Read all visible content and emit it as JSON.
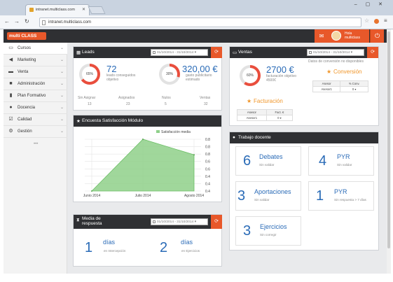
{
  "browser": {
    "tab_title": "intranet.multiclass.com",
    "url": "intranet.multiclass.com",
    "window_buttons": "– ▢ ✕"
  },
  "app": {
    "logo_prefix": "multi",
    "logo_main": "CLASS",
    "user_name": "Hola multiclass"
  },
  "sidebar": {
    "items": [
      {
        "label": "Cursos",
        "icon": "folder-icon"
      },
      {
        "label": "Marketing",
        "icon": "megaphone-icon"
      },
      {
        "label": "Venta",
        "icon": "card-icon"
      },
      {
        "label": "Administración",
        "icon": "briefcase-icon"
      },
      {
        "label": "Plan Formativo",
        "icon": "book-icon"
      },
      {
        "label": "Docencia",
        "icon": "users-icon"
      },
      {
        "label": "Calidad",
        "icon": "check-icon"
      },
      {
        "label": "Gestión",
        "icon": "gears-icon"
      }
    ]
  },
  "leads": {
    "title": "Leads",
    "date_range": "01/10/2014 - 31/10/2014",
    "ring_percent": "65%",
    "ring_value": 0.65,
    "count": "72",
    "count_caption": "leads conseguidos objetivo",
    "money": "320,00 €",
    "money_caption": "gasto publicitario estimado",
    "money_ring_percent": "30%",
    "money_ring_value": 0.3,
    "stats": [
      {
        "label": "Sin Asignar",
        "value": "13"
      },
      {
        "label": "Asignados",
        "value": "23"
      },
      {
        "label": "Nulos",
        "value": "5"
      },
      {
        "label": "Ventas",
        "value": "32"
      }
    ]
  },
  "ventas": {
    "title": "Ventas",
    "date_range": "01/10/2014 - 31/10/2014",
    "ring_percent": "60%",
    "ring_value": 0.6,
    "money": "2700 €",
    "money_caption": "facturación objetivo 4500€",
    "conv_note": "Datos de conversión no disponibles",
    "conversion_title": "Conversión",
    "conv_headers": [
      "Asesor",
      "% Conv."
    ],
    "conv_rows": [
      [
        "Asesor1",
        "0 ▾"
      ]
    ],
    "facturacion_title": "Facturación",
    "fact_headers": [
      "Asesor",
      "Fact. €"
    ],
    "fact_rows": [
      [
        "Asesor1",
        "0 ▾"
      ]
    ]
  },
  "encuesta": {
    "title": "Encuesta Satisfacción Módulo",
    "legend": "Satisfacción media",
    "chart_data": {
      "type": "area",
      "title": "Encuesta Satisfacción Módulo",
      "categories": [
        "Junio 2014",
        "Julio 2014",
        "Agosto 2014"
      ],
      "series": [
        {
          "name": "Satisfacción media",
          "values": [
            0.4,
            0.8,
            0.68
          ]
        }
      ],
      "ylim": [
        0.4,
        0.8
      ],
      "yticks": [
        "0.8",
        "0.8",
        "0.8",
        "0.6",
        "0.6",
        "0.4",
        "0.4",
        "0.4"
      ],
      "legend_position": "top-right",
      "grid": true,
      "color": "#8fd08a"
    }
  },
  "trabajo": {
    "title": "Trabajo docente",
    "cells": [
      {
        "n": "6",
        "title": "Debates",
        "sub": "Sin validar"
      },
      {
        "n": "4",
        "title": "PYR",
        "sub": "Sin validar"
      },
      {
        "n": "3",
        "title": "Aportaciones",
        "sub": "Sin validar"
      },
      {
        "n": "1",
        "title": "PYR",
        "sub": "Sin respuesta > 7 días"
      },
      {
        "n": "3",
        "title": "Ejercicios",
        "sub": "Sin corregir"
      }
    ]
  },
  "media": {
    "title": "Media de respuesta",
    "date_range": "01/10/2014 - 31/10/2014",
    "items": [
      {
        "n": "1",
        "unit": "días",
        "sub": "en Intercepción"
      },
      {
        "n": "2",
        "unit": "días",
        "sub": "en Ejercicios"
      }
    ]
  }
}
